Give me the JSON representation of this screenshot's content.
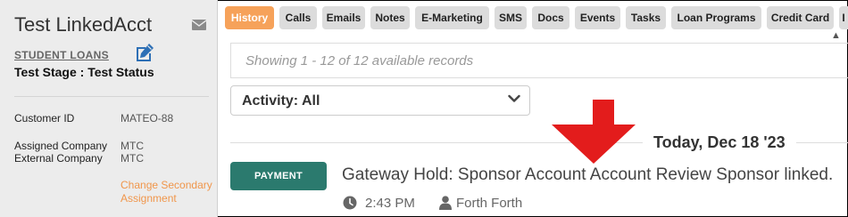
{
  "sidebar": {
    "account_name": "Test LinkedAcct",
    "loan_type": "STUDENT LOANS",
    "stage_status": "Test Stage : Test Status",
    "fields": [
      {
        "label": "Customer ID",
        "value": "MATEO-88"
      },
      {
        "label": "Assigned Company",
        "value": "MTC"
      },
      {
        "label": "External Company",
        "value": "MTC"
      }
    ],
    "change_assignment_line1": "Change Secondary",
    "change_assignment_line2": "Assignment"
  },
  "tabs": [
    {
      "label": "History",
      "active": true
    },
    {
      "label": "Calls"
    },
    {
      "label": "Emails"
    },
    {
      "label": "Notes"
    },
    {
      "label": "E-Marketing"
    },
    {
      "label": "SMS"
    },
    {
      "label": "Docs"
    },
    {
      "label": "Events"
    },
    {
      "label": "Tasks"
    },
    {
      "label": "Loan Programs"
    },
    {
      "label": "Credit Card"
    },
    {
      "label": "I"
    }
  ],
  "records_summary": "Showing 1 - 12 of 12 available records",
  "activity_filter": "Activity: All",
  "date_heading": "Today, Dec 18 '23",
  "activity": {
    "badge": "PAYMENT",
    "title": "Gateway Hold: Sponsor Account Account Review Sponsor linked.",
    "time": "2:43 PM",
    "user": "Forth Forth"
  },
  "colors": {
    "active_tab": "#f6a25a",
    "badge": "#2b7a6e",
    "link": "#f0964b",
    "arrow": "#e31c1c"
  }
}
